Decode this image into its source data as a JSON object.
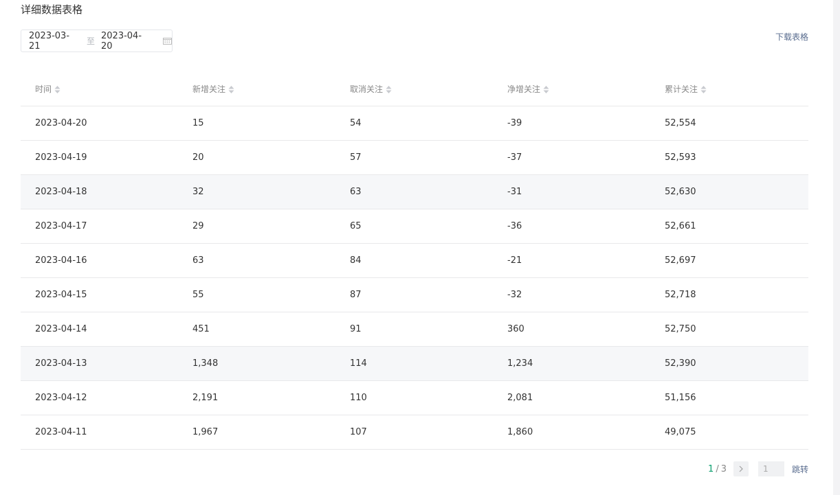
{
  "title": "详细数据表格",
  "date_range": {
    "start": "2023-03-21",
    "separator": "至",
    "end": "2023-04-20"
  },
  "download_label": "下载表格",
  "columns": [
    "时间",
    "新增关注",
    "取消关注",
    "净增关注",
    "累计关注"
  ],
  "rows": [
    [
      "2023-04-20",
      "15",
      "54",
      "-39",
      "52,554"
    ],
    [
      "2023-04-19",
      "20",
      "57",
      "-37",
      "52,593"
    ],
    [
      "2023-04-18",
      "32",
      "63",
      "-31",
      "52,630"
    ],
    [
      "2023-04-17",
      "29",
      "65",
      "-36",
      "52,661"
    ],
    [
      "2023-04-16",
      "63",
      "84",
      "-21",
      "52,697"
    ],
    [
      "2023-04-15",
      "55",
      "87",
      "-32",
      "52,718"
    ],
    [
      "2023-04-14",
      "451",
      "91",
      "360",
      "52,750"
    ],
    [
      "2023-04-13",
      "1,348",
      "114",
      "1,234",
      "52,390"
    ],
    [
      "2023-04-12",
      "2,191",
      "110",
      "2,081",
      "51,156"
    ],
    [
      "2023-04-11",
      "1,967",
      "107",
      "1,860",
      "49,075"
    ]
  ],
  "pagination": {
    "current": "1",
    "separator": "/",
    "total": "3",
    "next_icon": "chevron-right-icon",
    "jump_value": "1",
    "jump_label": "跳转"
  },
  "colors": {
    "accent": "#0a9e6e",
    "link": "#5a6d8f",
    "row_highlight": "#f6f7f9"
  }
}
